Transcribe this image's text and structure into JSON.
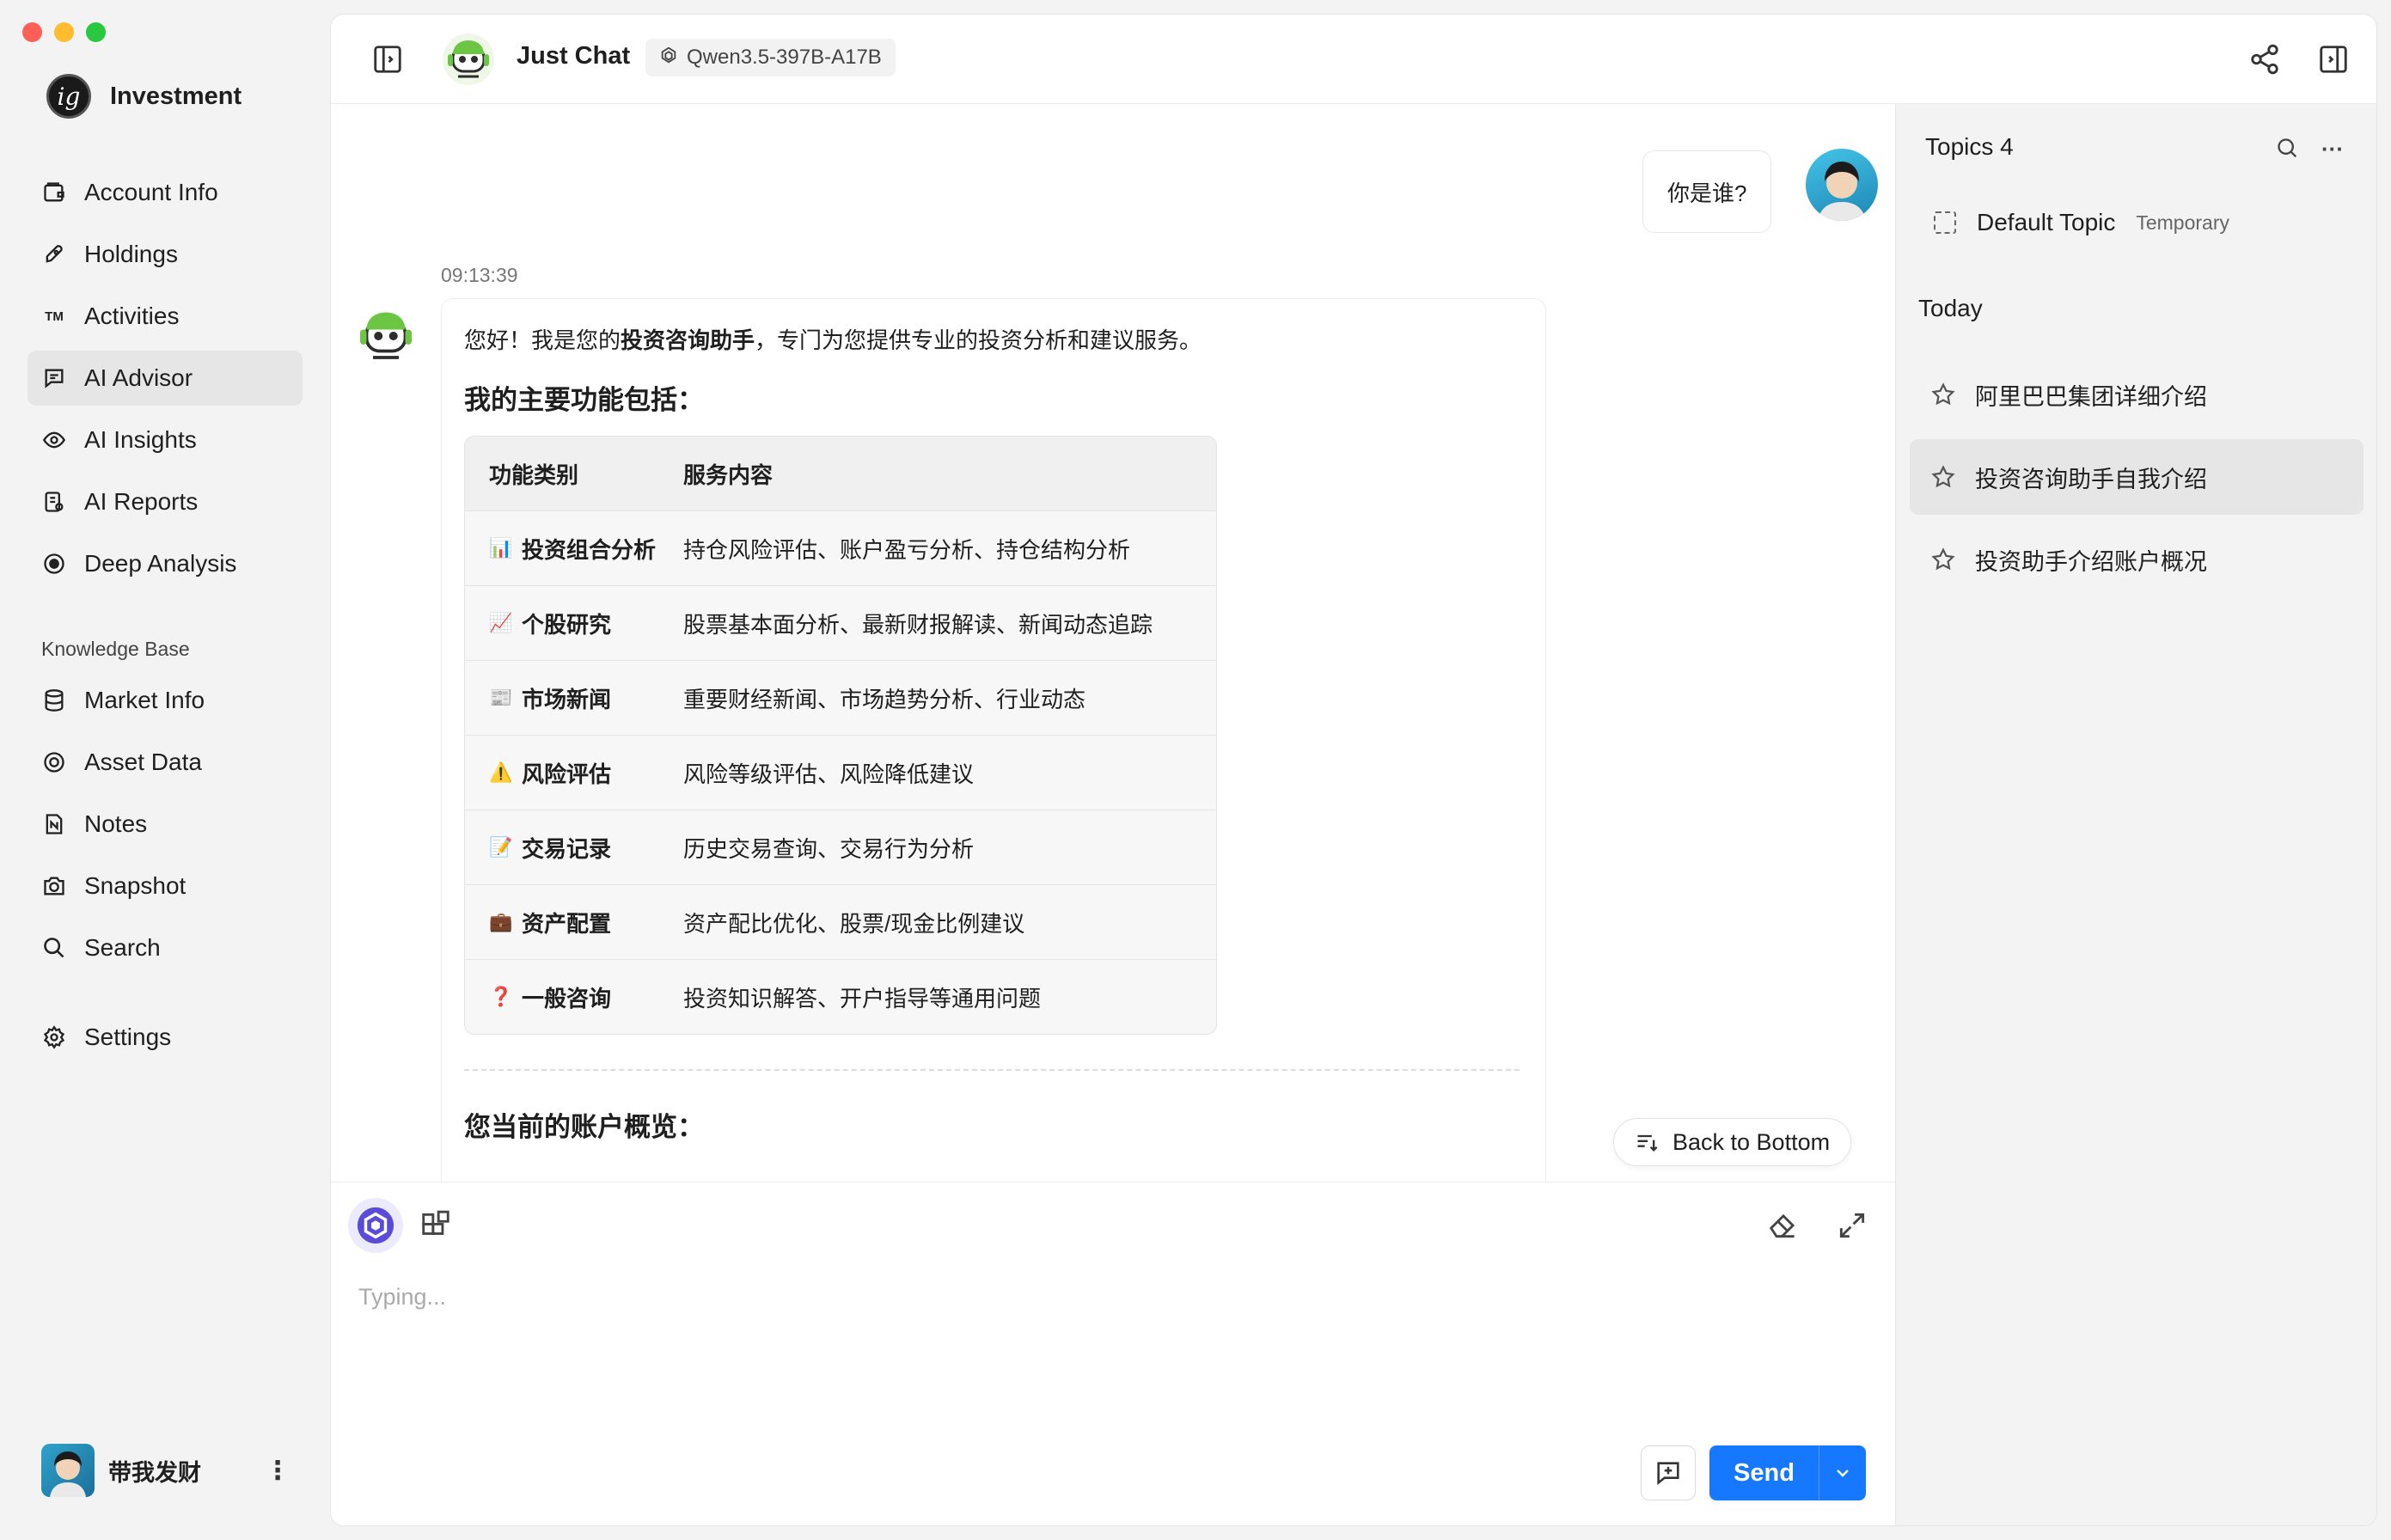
{
  "app": {
    "name": "Investment"
  },
  "sidebar": {
    "items": [
      {
        "label": "Account Info",
        "icon": "wallet-icon"
      },
      {
        "label": "Holdings",
        "icon": "rocket-icon"
      },
      {
        "label": "Activities",
        "icon": "trademark-icon"
      },
      {
        "label": "AI Advisor",
        "icon": "chat-icon"
      },
      {
        "label": "AI Insights",
        "icon": "eye-icon"
      },
      {
        "label": "AI Reports",
        "icon": "report-icon"
      },
      {
        "label": "Deep Analysis",
        "icon": "target-icon"
      }
    ],
    "kb_section": "Knowledge Base",
    "kb_items": [
      {
        "label": "Market Info",
        "icon": "database-icon"
      },
      {
        "label": "Asset Data",
        "icon": "target-icon"
      },
      {
        "label": "Notes",
        "icon": "file-icon"
      },
      {
        "label": "Snapshot",
        "icon": "camera-icon"
      },
      {
        "label": "Search",
        "icon": "search-icon"
      }
    ],
    "settings": "Settings",
    "user": {
      "name": "带我发财"
    }
  },
  "header": {
    "title": "Just Chat",
    "model": "Qwen3.5-397B-A17B"
  },
  "chat": {
    "user_message": "你是谁?",
    "timestamp": "09:13:39",
    "intro_prefix": "您好！我是您的",
    "intro_bold": "投资咨询助手",
    "intro_suffix": "，专门为您提供专业的投资分析和建议服务。",
    "heading": "我的主要功能包括：",
    "table": {
      "headers": [
        "功能类别",
        "服务内容"
      ],
      "rows": [
        {
          "emoji": "📊",
          "category": "投资组合分析",
          "content": "持仓风险评估、账户盈亏分析、持仓结构分析"
        },
        {
          "emoji": "📈",
          "category": "个股研究",
          "content": "股票基本面分析、最新财报解读、新闻动态追踪"
        },
        {
          "emoji": "📰",
          "category": "市场新闻",
          "content": "重要财经新闻、市场趋势分析、行业动态"
        },
        {
          "emoji": "⚠️",
          "category": "风险评估",
          "content": "风险等级评估、风险降低建议"
        },
        {
          "emoji": "📝",
          "category": "交易记录",
          "content": "历史交易查询、交易行为分析"
        },
        {
          "emoji": "💼",
          "category": "资产配置",
          "content": "资产配比优化、股票/现金比例建议"
        },
        {
          "emoji": "❓",
          "category": "一般咨询",
          "content": "投资知识解答、开户指导等通用问题"
        }
      ]
    },
    "heading2": "您当前的账户概览：",
    "back_to_bottom": "Back to Bottom"
  },
  "composer": {
    "placeholder": "Typing...",
    "send": "Send"
  },
  "topics": {
    "title": "Topics 4",
    "default_label": "Default Topic",
    "default_tag": "Temporary",
    "group": "Today",
    "items": [
      {
        "label": "阿里巴巴集团详细介绍"
      },
      {
        "label": "投资咨询助手自我介绍"
      },
      {
        "label": "投资助手介绍账户概况"
      }
    ]
  },
  "colors": {
    "accent": "#1677ff",
    "traffic_red": "#ff5f57",
    "traffic_yellow": "#febc2e",
    "traffic_green": "#28c840",
    "bot_green": "#6cc644"
  }
}
